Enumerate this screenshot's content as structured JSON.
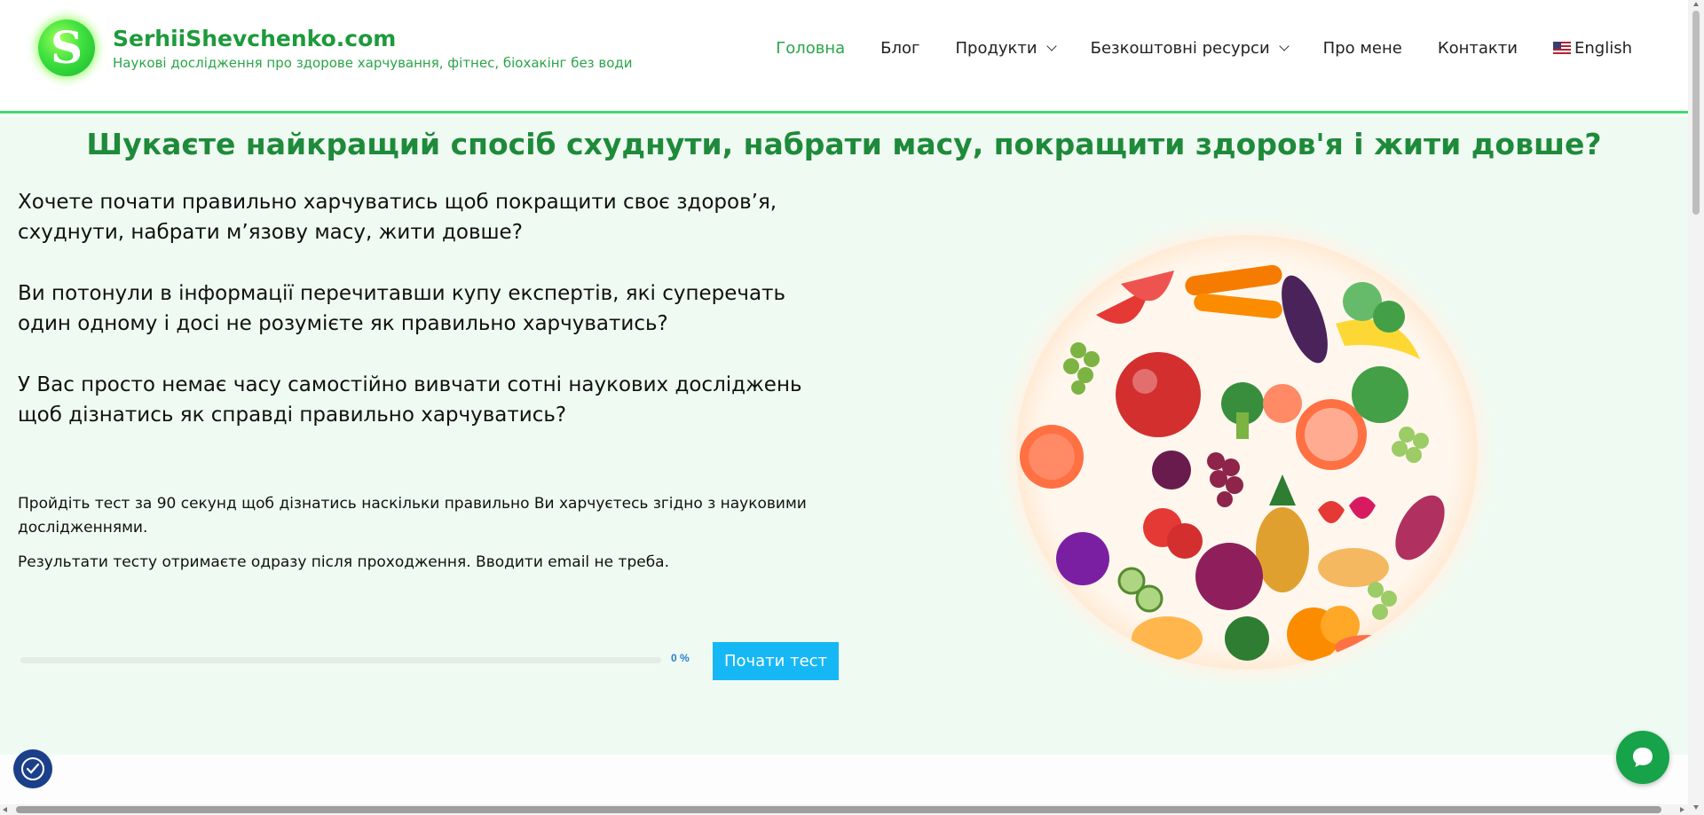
{
  "header": {
    "logo_letter": "S",
    "site_title": "SerhiiShevchenko.com",
    "tagline": "Наукові дослідження про здорове харчування, фітнес, біохакінг без води"
  },
  "nav": {
    "items": [
      {
        "label": "Головна"
      },
      {
        "label": "Блог"
      },
      {
        "label": "Продукти"
      },
      {
        "label": "Безкоштовні ресурси"
      },
      {
        "label": "Про мене"
      },
      {
        "label": "Контакти"
      },
      {
        "label": "English",
        "flag_icon": "us-flag-icon"
      }
    ],
    "active_color": "#28a745"
  },
  "hero": {
    "title": "Шукаєте найкращий спосіб схуднути, набрати масу, покращити здоров'я і жити довше?",
    "p1": "Хочете почати правильно харчуватись щоб покращити своє здоров’я, схуднути, набрати м’язову масу, жити довше?",
    "p2": "Ви потонули в інформації перечитавши купу експертів, які суперечать один одному і досі не розумієте як правильно харчуватись?",
    "p3": "У Вас просто немає часу самостійно вивчати сотні наукових досліджень щоб дізнатись як справді правильно харчуватись?",
    "s1": "Пройдіть тест за 90 секунд щоб дізнатись наскільки правильно Ви харчуєтесь згідно з науковими дослідженнями.",
    "s2": "Результати тесту отримаєте одразу після проходження. Вводити email не треба.",
    "progress_value": 0,
    "progress_label": "0 %",
    "start_button": "Почати тест",
    "image_icon": "fruit-vegetable-circle-image"
  },
  "colors": {
    "brand_green": "#1e9a3b",
    "hero_bg": "#effbf2",
    "button_blue": "#16b7f5",
    "chat_green": "#17a34a",
    "accessibility_blue": "#1b3f8b"
  },
  "widgets": {
    "accessibility_icon": "accessibility-icon",
    "chat_icon": "chat-bubble-icon"
  }
}
